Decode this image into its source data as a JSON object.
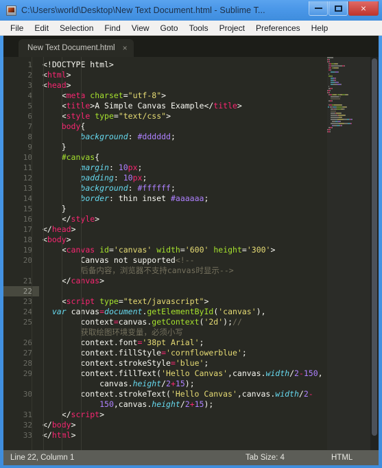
{
  "window": {
    "title": "C:\\Users\\world\\Desktop\\New Text Document.html - Sublime T...",
    "app_icon": "sublime-text-icon",
    "minimize_label": "",
    "maximize_label": "",
    "close_label": "×"
  },
  "menu": {
    "items": [
      {
        "label": "File"
      },
      {
        "label": "Edit"
      },
      {
        "label": "Selection"
      },
      {
        "label": "Find"
      },
      {
        "label": "View"
      },
      {
        "label": "Goto"
      },
      {
        "label": "Tools"
      },
      {
        "label": "Project"
      },
      {
        "label": "Preferences"
      },
      {
        "label": "Help"
      }
    ]
  },
  "tabs": [
    {
      "label": "New Text Document.html",
      "close": "×",
      "active": true
    }
  ],
  "statusbar": {
    "cursor": "Line 22, Column 1",
    "tab_size": "Tab Size: 4",
    "syntax": "HTML"
  },
  "editor": {
    "active_line": 22,
    "theme_colors": {
      "background": "#282923",
      "gutter_text": "#6a6b63",
      "active_line": "#48493f",
      "tag": "#f92672",
      "attribute": "#a6e22e",
      "string": "#e6db74",
      "property": "#66d9ef",
      "value": "#ae81ff",
      "comment": "#75715e",
      "plain": "#f8f8f2"
    },
    "gutter_numbers": [
      "1",
      "2",
      "3",
      "4",
      "5",
      "6",
      "7",
      "8",
      "9",
      "10",
      "11",
      "12",
      "13",
      "14",
      "15",
      "16",
      "17",
      "18",
      "19",
      "20",
      "",
      "21",
      "22",
      "23",
      "24",
      "25",
      "",
      "26",
      "27",
      "28",
      "29",
      "",
      "30",
      "",
      "31",
      "32",
      "33"
    ],
    "lines": [
      {
        "n": 1,
        "tokens": [
          {
            "t": "<!DOCTYPE html>",
            "c": "t-doctype"
          }
        ]
      },
      {
        "n": 2,
        "tokens": [
          {
            "t": "<",
            "c": "t-punct"
          },
          {
            "t": "html",
            "c": "t-tag"
          },
          {
            "t": ">",
            "c": "t-punct"
          }
        ]
      },
      {
        "n": 3,
        "tokens": [
          {
            "t": "<",
            "c": "t-punct"
          },
          {
            "t": "head",
            "c": "t-tag"
          },
          {
            "t": ">",
            "c": "t-punct"
          }
        ]
      },
      {
        "n": 4,
        "tokens": [
          {
            "t": "    <",
            "c": "t-punct"
          },
          {
            "t": "meta",
            "c": "t-tag"
          },
          {
            "t": " ",
            "c": "t-plain"
          },
          {
            "t": "charset",
            "c": "t-attr"
          },
          {
            "t": "=",
            "c": "t-punct"
          },
          {
            "t": "\"utf-8\"",
            "c": "t-str"
          },
          {
            "t": ">",
            "c": "t-punct"
          }
        ]
      },
      {
        "n": 5,
        "tokens": [
          {
            "t": "    <",
            "c": "t-punct"
          },
          {
            "t": "title",
            "c": "t-tag"
          },
          {
            "t": ">",
            "c": "t-punct"
          },
          {
            "t": "A Simple Canvas Example",
            "c": "t-plain"
          },
          {
            "t": "</",
            "c": "t-punct"
          },
          {
            "t": "title",
            "c": "t-tag"
          },
          {
            "t": ">",
            "c": "t-punct"
          }
        ]
      },
      {
        "n": 6,
        "tokens": [
          {
            "t": "    <",
            "c": "t-punct"
          },
          {
            "t": "style",
            "c": "t-tag"
          },
          {
            "t": " ",
            "c": "t-plain"
          },
          {
            "t": "type",
            "c": "t-attr"
          },
          {
            "t": "=",
            "c": "t-punct"
          },
          {
            "t": "\"text/css\"",
            "c": "t-str"
          },
          {
            "t": ">",
            "c": "t-punct"
          }
        ]
      },
      {
        "n": 7,
        "tokens": [
          {
            "t": "    ",
            "c": "t-plain"
          },
          {
            "t": "body",
            "c": "t-tag"
          },
          {
            "t": "{",
            "c": "t-plain"
          }
        ]
      },
      {
        "n": 8,
        "tokens": [
          {
            "t": "        ",
            "c": "t-plain"
          },
          {
            "t": "background",
            "c": "t-prop"
          },
          {
            "t": ": ",
            "c": "t-plain"
          },
          {
            "t": "#dddddd",
            "c": "t-val"
          },
          {
            "t": ";",
            "c": "t-plain"
          }
        ]
      },
      {
        "n": 9,
        "tokens": [
          {
            "t": "    }",
            "c": "t-plain"
          }
        ]
      },
      {
        "n": 10,
        "tokens": [
          {
            "t": "    ",
            "c": "t-plain"
          },
          {
            "t": "#canvas",
            "c": "t-sel"
          },
          {
            "t": "{",
            "c": "t-plain"
          }
        ]
      },
      {
        "n": 11,
        "tokens": [
          {
            "t": "        ",
            "c": "t-plain"
          },
          {
            "t": "margin",
            "c": "t-prop"
          },
          {
            "t": ": ",
            "c": "t-plain"
          },
          {
            "t": "10",
            "c": "t-val"
          },
          {
            "t": "px",
            "c": "t-unit"
          },
          {
            "t": ";",
            "c": "t-plain"
          }
        ]
      },
      {
        "n": 12,
        "tokens": [
          {
            "t": "        ",
            "c": "t-plain"
          },
          {
            "t": "padding",
            "c": "t-prop"
          },
          {
            "t": ": ",
            "c": "t-plain"
          },
          {
            "t": "10",
            "c": "t-val"
          },
          {
            "t": "px",
            "c": "t-unit"
          },
          {
            "t": ";",
            "c": "t-plain"
          }
        ]
      },
      {
        "n": 13,
        "tokens": [
          {
            "t": "        ",
            "c": "t-plain"
          },
          {
            "t": "background",
            "c": "t-prop"
          },
          {
            "t": ": ",
            "c": "t-plain"
          },
          {
            "t": "#ffffff",
            "c": "t-val"
          },
          {
            "t": ";",
            "c": "t-plain"
          }
        ]
      },
      {
        "n": 14,
        "tokens": [
          {
            "t": "        ",
            "c": "t-plain"
          },
          {
            "t": "border",
            "c": "t-prop"
          },
          {
            "t": ": ",
            "c": "t-plain"
          },
          {
            "t": "thin inset ",
            "c": "t-plain"
          },
          {
            "t": "#aaaaaa",
            "c": "t-val"
          },
          {
            "t": ";",
            "c": "t-plain"
          }
        ]
      },
      {
        "n": 15,
        "tokens": [
          {
            "t": "    }",
            "c": "t-plain"
          }
        ]
      },
      {
        "n": 16,
        "tokens": [
          {
            "t": "    </",
            "c": "t-punct"
          },
          {
            "t": "style",
            "c": "t-tag"
          },
          {
            "t": ">",
            "c": "t-punct"
          }
        ]
      },
      {
        "n": 17,
        "tokens": [
          {
            "t": "</",
            "c": "t-punct"
          },
          {
            "t": "head",
            "c": "t-tag"
          },
          {
            "t": ">",
            "c": "t-punct"
          }
        ]
      },
      {
        "n": 18,
        "tokens": [
          {
            "t": "<",
            "c": "t-punct"
          },
          {
            "t": "body",
            "c": "t-tag"
          },
          {
            "t": ">",
            "c": "t-punct"
          }
        ]
      },
      {
        "n": 19,
        "tokens": [
          {
            "t": "    <",
            "c": "t-punct"
          },
          {
            "t": "canvas",
            "c": "t-tag"
          },
          {
            "t": " ",
            "c": "t-plain"
          },
          {
            "t": "id",
            "c": "t-attr"
          },
          {
            "t": "=",
            "c": "t-punct"
          },
          {
            "t": "'canvas'",
            "c": "t-str"
          },
          {
            "t": " ",
            "c": "t-plain"
          },
          {
            "t": "width",
            "c": "t-attr"
          },
          {
            "t": "=",
            "c": "t-punct"
          },
          {
            "t": "'600'",
            "c": "t-str"
          },
          {
            "t": " ",
            "c": "t-plain"
          },
          {
            "t": "height",
            "c": "t-attr"
          },
          {
            "t": "=",
            "c": "t-punct"
          },
          {
            "t": "'300'",
            "c": "t-str"
          },
          {
            "t": ">",
            "c": "t-punct"
          }
        ]
      },
      {
        "n": 20,
        "tokens": [
          {
            "t": "        Canvas not supported",
            "c": "t-plain"
          },
          {
            "t": "<!--",
            "c": "t-comment"
          }
        ]
      },
      {
        "n": null,
        "wrap": true,
        "tokens": [
          {
            "t": "        后备内容，浏览器不支持canvas时显示-->",
            "c": "t-comment"
          }
        ]
      },
      {
        "n": 21,
        "tokens": [
          {
            "t": "    </",
            "c": "t-punct"
          },
          {
            "t": "canvas",
            "c": "t-tag"
          },
          {
            "t": ">",
            "c": "t-punct"
          }
        ]
      },
      {
        "n": 22,
        "active": true,
        "tokens": [
          {
            "t": "",
            "c": "t-plain"
          }
        ]
      },
      {
        "n": 23,
        "tokens": [
          {
            "t": "    <",
            "c": "t-punct"
          },
          {
            "t": "script",
            "c": "t-tag"
          },
          {
            "t": " ",
            "c": "t-plain"
          },
          {
            "t": "type",
            "c": "t-attr"
          },
          {
            "t": "=",
            "c": "t-punct"
          },
          {
            "t": "\"text/javascript\"",
            "c": "t-str"
          },
          {
            "t": ">",
            "c": "t-punct"
          }
        ]
      },
      {
        "n": 24,
        "tokens": [
          {
            "t": "  ",
            "c": "t-plain"
          },
          {
            "t": "var",
            "c": "t-kw"
          },
          {
            "t": " canvas",
            "c": "t-plain"
          },
          {
            "t": "=",
            "c": "t-op"
          },
          {
            "t": "document",
            "c": "t-kw"
          },
          {
            "t": ".",
            "c": "t-plain"
          },
          {
            "t": "getElementById",
            "c": "t-fn"
          },
          {
            "t": "(",
            "c": "t-plain"
          },
          {
            "t": "'canvas'",
            "c": "t-str"
          },
          {
            "t": "),",
            "c": "t-plain"
          }
        ]
      },
      {
        "n": 25,
        "tokens": [
          {
            "t": "        context",
            "c": "t-plain"
          },
          {
            "t": "=",
            "c": "t-op"
          },
          {
            "t": "canvas.",
            "c": "t-plain"
          },
          {
            "t": "getContext",
            "c": "t-fn"
          },
          {
            "t": "(",
            "c": "t-plain"
          },
          {
            "t": "'2d'",
            "c": "t-str"
          },
          {
            "t": ");",
            "c": "t-plain"
          },
          {
            "t": "//",
            "c": "t-comment"
          }
        ]
      },
      {
        "n": null,
        "wrap": true,
        "tokens": [
          {
            "t": "        获取绘图环境变量，必须小写",
            "c": "t-comment"
          }
        ]
      },
      {
        "n": 26,
        "tokens": [
          {
            "t": "        context.font",
            "c": "t-plain"
          },
          {
            "t": "=",
            "c": "t-op"
          },
          {
            "t": "'38pt Arial'",
            "c": "t-str"
          },
          {
            "t": ";",
            "c": "t-plain"
          }
        ]
      },
      {
        "n": 27,
        "tokens": [
          {
            "t": "        context.fillStyle",
            "c": "t-plain"
          },
          {
            "t": "=",
            "c": "t-op"
          },
          {
            "t": "'cornflowerblue'",
            "c": "t-str"
          },
          {
            "t": ";",
            "c": "t-plain"
          }
        ]
      },
      {
        "n": 28,
        "tokens": [
          {
            "t": "        context.strokeStyle",
            "c": "t-plain"
          },
          {
            "t": "=",
            "c": "t-op"
          },
          {
            "t": "'blue'",
            "c": "t-str"
          },
          {
            "t": ";",
            "c": "t-plain"
          }
        ]
      },
      {
        "n": 29,
        "tokens": [
          {
            "t": "        context.",
            "c": "t-plain"
          },
          {
            "t": "fillText",
            "c": "t-plain"
          },
          {
            "t": "(",
            "c": "t-plain"
          },
          {
            "t": "'Hello Canvas'",
            "c": "t-str"
          },
          {
            "t": ",canvas.",
            "c": "t-plain"
          },
          {
            "t": "width",
            "c": "t-prop"
          },
          {
            "t": "/",
            "c": "t-plain"
          },
          {
            "t": "2",
            "c": "t-val"
          },
          {
            "t": "-",
            "c": "t-op"
          },
          {
            "t": "150",
            "c": "t-val"
          },
          {
            "t": ",",
            "c": "t-plain"
          }
        ]
      },
      {
        "n": null,
        "wrap": true,
        "tokens": [
          {
            "t": "            canvas.",
            "c": "t-plain"
          },
          {
            "t": "height",
            "c": "t-prop"
          },
          {
            "t": "/",
            "c": "t-plain"
          },
          {
            "t": "2",
            "c": "t-val"
          },
          {
            "t": "+",
            "c": "t-op"
          },
          {
            "t": "15",
            "c": "t-val"
          },
          {
            "t": ");",
            "c": "t-plain"
          }
        ]
      },
      {
        "n": 30,
        "tokens": [
          {
            "t": "        context.strokeText(",
            "c": "t-plain"
          },
          {
            "t": "'Hello Canvas'",
            "c": "t-str"
          },
          {
            "t": ",canvas.",
            "c": "t-plain"
          },
          {
            "t": "width",
            "c": "t-prop"
          },
          {
            "t": "/",
            "c": "t-plain"
          },
          {
            "t": "2",
            "c": "t-val"
          },
          {
            "t": "-",
            "c": "t-op"
          }
        ]
      },
      {
        "n": null,
        "wrap": true,
        "tokens": [
          {
            "t": "            ",
            "c": "t-plain"
          },
          {
            "t": "150",
            "c": "t-val"
          },
          {
            "t": ",canvas.",
            "c": "t-plain"
          },
          {
            "t": "height",
            "c": "t-prop"
          },
          {
            "t": "/",
            "c": "t-plain"
          },
          {
            "t": "2",
            "c": "t-val"
          },
          {
            "t": "+",
            "c": "t-op"
          },
          {
            "t": "15",
            "c": "t-val"
          },
          {
            "t": ");",
            "c": "t-plain"
          }
        ]
      },
      {
        "n": 31,
        "tokens": [
          {
            "t": "    </",
            "c": "t-punct"
          },
          {
            "t": "script",
            "c": "t-tag"
          },
          {
            "t": ">",
            "c": "t-punct"
          }
        ]
      },
      {
        "n": 32,
        "tokens": [
          {
            "t": "</",
            "c": "t-punct"
          },
          {
            "t": "body",
            "c": "t-tag"
          },
          {
            "t": ">",
            "c": "t-punct"
          }
        ]
      },
      {
        "n": 33,
        "tokens": [
          {
            "t": "</",
            "c": "t-punct"
          },
          {
            "t": "html",
            "c": "t-tag"
          },
          {
            "t": ">",
            "c": "t-punct"
          }
        ]
      }
    ]
  }
}
